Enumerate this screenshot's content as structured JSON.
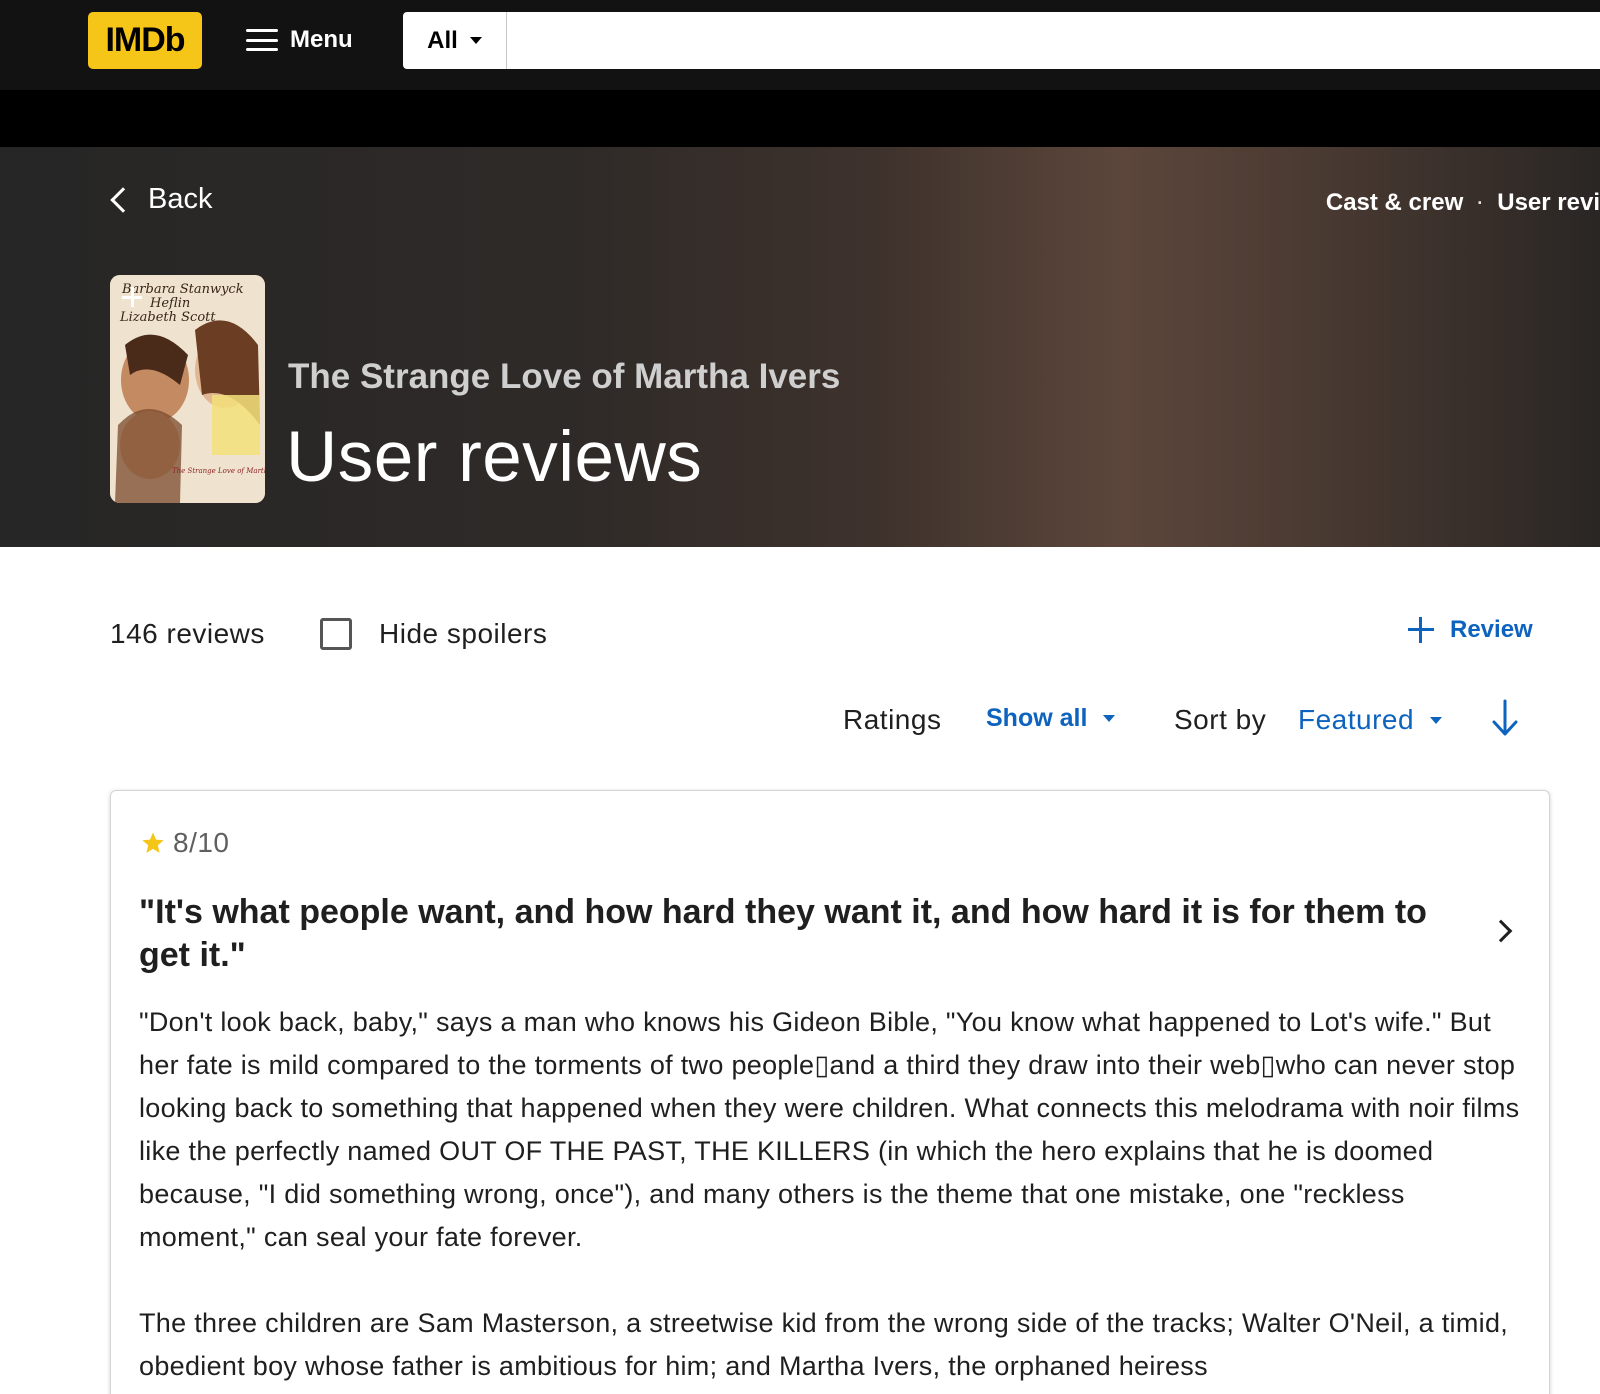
{
  "header": {
    "logo_text": "IMDb",
    "menu_label": "Menu",
    "search_category": "All",
    "search_placeholder": ""
  },
  "hero": {
    "back_label": "Back",
    "links": [
      "Cast & crew",
      "·",
      "User revi"
    ],
    "movie_title": "The Strange Love of Martha Ivers",
    "page_title": "User reviews",
    "poster_text": [
      "Barbara Stanwyck",
      "Heflin",
      "Lizabeth Scott",
      "The Strange Love of Martha Ivers"
    ]
  },
  "controls": {
    "review_count": "146 reviews",
    "hide_spoilers_label": "Hide spoilers",
    "hide_spoilers_checked": false,
    "add_review_label": "Review",
    "ratings_label": "Ratings",
    "ratings_value": "Show all",
    "sort_label": "Sort by",
    "sort_value": "Featured"
  },
  "review": {
    "rating": "8/10",
    "title": "\"It's what people want, and how hard they want it, and how hard it is for them to get it.\"",
    "paragraphs": [
      "\"Don't look back, baby,\" says a man who knows his Gideon Bible, \"You know what happened to Lot's wife.\" But her fate is mild compared to the torments of two people▯and a third they draw into their web▯who can never stop looking back to something that happened when they were children. What connects this melodrama with noir films like the perfectly named OUT OF THE PAST, THE KILLERS (in which the hero explains that he is doomed because, \"I did something wrong, once\"), and many others is the theme that one mistake, one \"reckless moment,\" can seal your fate forever.",
      "The three children are Sam Masterson, a streetwise kid from the wrong side of the tracks; Walter O'Neil, a timid, obedient boy whose father is ambitious for him; and Martha Ivers, the orphaned heiress"
    ]
  },
  "colors": {
    "accent_blue": "#0e63be",
    "imdb_yellow": "#f5c518",
    "star_yellow": "#f5c518",
    "nav_bg": "#121212"
  },
  "icons": {
    "menu": "hamburger-icon",
    "back": "chevron-left-icon",
    "add": "plus-icon",
    "sort_direction": "arrow-down-icon",
    "rating": "star-icon",
    "expand": "chevron-right-icon"
  }
}
